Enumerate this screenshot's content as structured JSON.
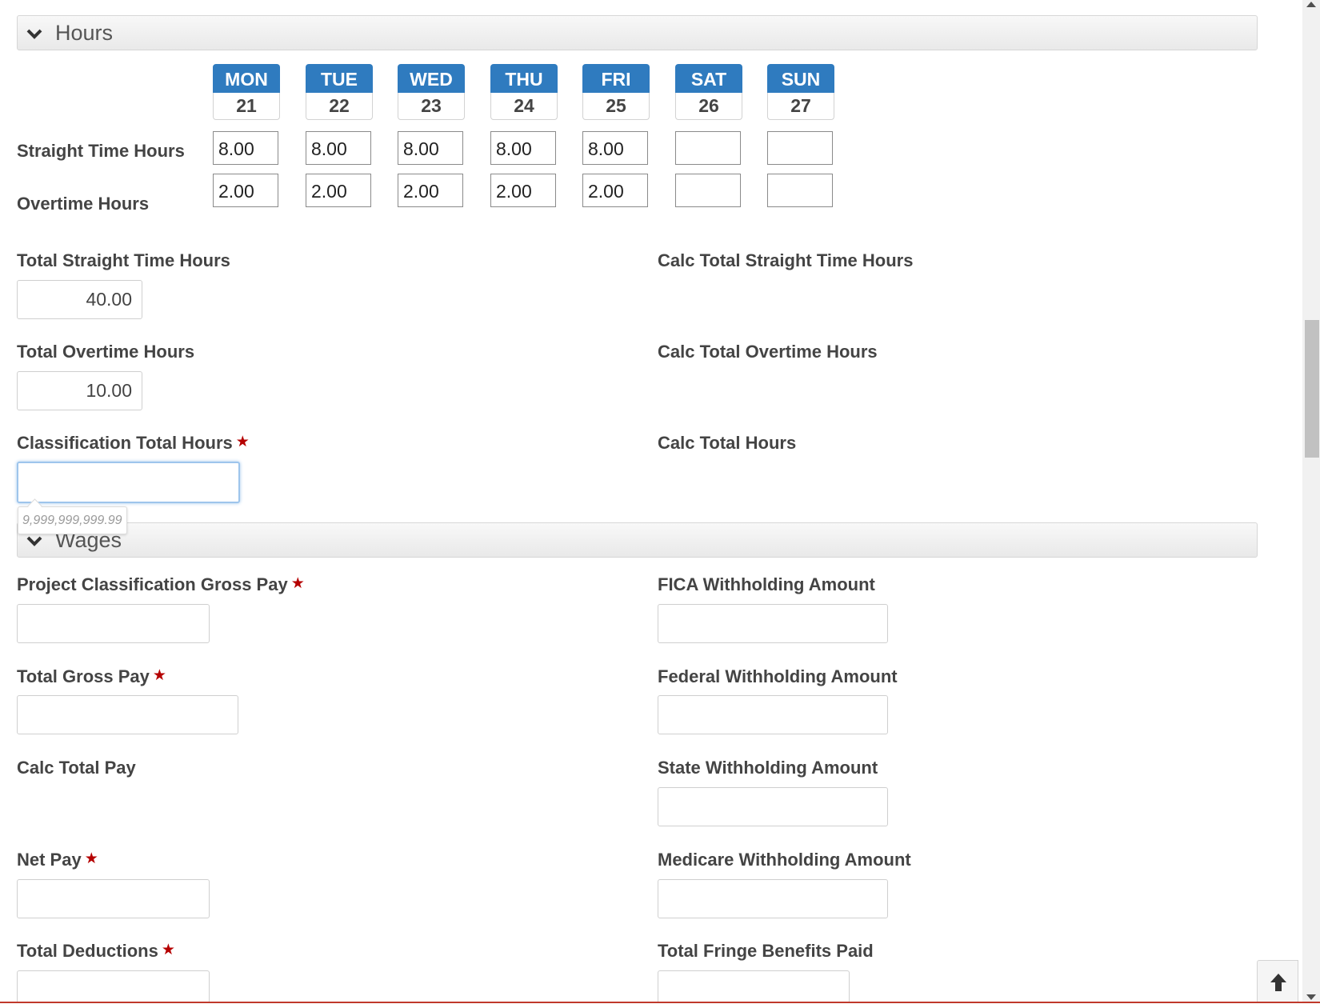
{
  "hours_section": {
    "title": "Hours"
  },
  "days": [
    {
      "name": "MON",
      "date": "21",
      "straight": "8.00",
      "overtime": "2.00"
    },
    {
      "name": "TUE",
      "date": "22",
      "straight": "8.00",
      "overtime": "2.00"
    },
    {
      "name": "WED",
      "date": "23",
      "straight": "8.00",
      "overtime": "2.00"
    },
    {
      "name": "THU",
      "date": "24",
      "straight": "8.00",
      "overtime": "2.00"
    },
    {
      "name": "FRI",
      "date": "25",
      "straight": "8.00",
      "overtime": "2.00"
    },
    {
      "name": "SAT",
      "date": "26",
      "straight": "",
      "overtime": ""
    },
    {
      "name": "SUN",
      "date": "27",
      "straight": "",
      "overtime": ""
    }
  ],
  "row_labels": {
    "straight": "Straight Time Hours",
    "overtime": "Overtime Hours"
  },
  "totals": {
    "straight_label": "Total Straight Time Hours",
    "straight_value": "40.00",
    "calc_straight_label": "Calc Total Straight Time Hours",
    "overtime_label": "Total Overtime Hours",
    "overtime_value": "10.00",
    "calc_overtime_label": "Calc Total Overtime Hours",
    "classification_label": "Classification Total Hours",
    "classification_value": "",
    "classification_hint": "9,999,999,999.99",
    "calc_total_label": "Calc Total Hours"
  },
  "wages_section": {
    "title": "Wages"
  },
  "wages": {
    "project_gross_label": "Project Classification Gross Pay",
    "fica_label": "FICA Withholding Amount",
    "total_gross_label": "Total Gross Pay",
    "federal_label": "Federal Withholding Amount",
    "calc_total_pay_label": "Calc Total Pay",
    "state_label": "State Withholding Amount",
    "net_pay_label": "Net Pay",
    "medicare_label": "Medicare Withholding Amount",
    "total_deductions_label": "Total Deductions",
    "fringe_label": "Total Fringe Benefits Paid"
  },
  "required_marker": "★",
  "colors": {
    "day_header": "#2f7bbf",
    "required": "#b50000",
    "focus": "#9ec5ec"
  }
}
